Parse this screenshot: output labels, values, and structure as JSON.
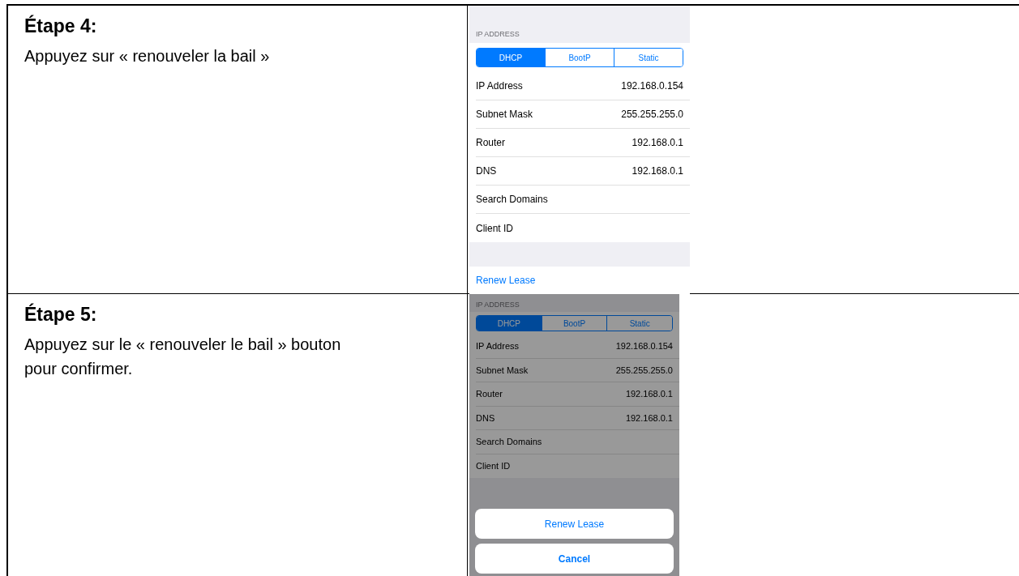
{
  "steps": [
    {
      "title": "Étape 4:",
      "text": "Appuyez sur « renouveler la bail »",
      "screenshot": {
        "dimmed": false,
        "section_header": "IP ADDRESS",
        "segments": [
          {
            "label": "DHCP",
            "selected": true
          },
          {
            "label": "BootP",
            "selected": false
          },
          {
            "label": "Static",
            "selected": false
          }
        ],
        "rows": [
          {
            "label": "IP Address",
            "value": "192.168.0.154"
          },
          {
            "label": "Subnet Mask",
            "value": "255.255.255.0"
          },
          {
            "label": "Router",
            "value": "192.168.0.1"
          },
          {
            "label": "DNS",
            "value": "192.168.0.1"
          },
          {
            "label": "Search Domains"
          },
          {
            "label": "Client ID"
          }
        ],
        "link": "Renew Lease"
      }
    },
    {
      "title": "Étape 5:",
      "text": "Appuyez sur le « renouveler le bail » bouton pour confirmer.",
      "screenshot": {
        "dimmed": true,
        "section_header": "IP ADDRESS",
        "segments": [
          {
            "label": "DHCP",
            "selected": true
          },
          {
            "label": "BootP",
            "selected": false
          },
          {
            "label": "Static",
            "selected": false
          }
        ],
        "rows": [
          {
            "label": "IP Address",
            "value": "192.168.0.154"
          },
          {
            "label": "Subnet Mask",
            "value": "255.255.255.0"
          },
          {
            "label": "Router",
            "value": "192.168.0.1"
          },
          {
            "label": "DNS",
            "value": "192.168.0.1"
          },
          {
            "label": "Search Domains"
          },
          {
            "label": "Client ID"
          }
        ],
        "action_sheet": [
          {
            "label": "Renew Lease",
            "kind": "action"
          },
          {
            "label": "Cancel",
            "kind": "cancel"
          }
        ]
      }
    }
  ]
}
